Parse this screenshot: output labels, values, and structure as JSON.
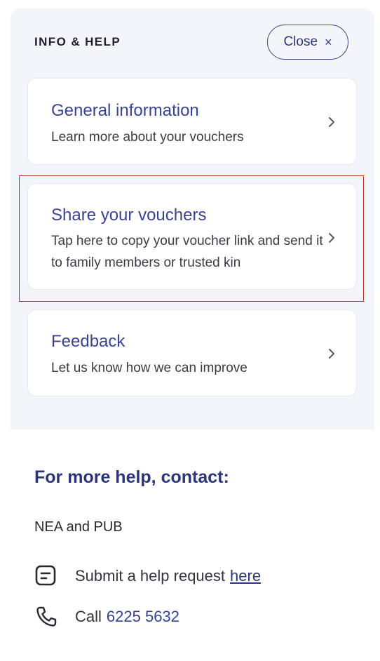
{
  "panel": {
    "title": "INFO & HELP",
    "close_label": "Close",
    "close_icon": "×"
  },
  "cards": [
    {
      "title": "General information",
      "description": "Learn more about your vouchers",
      "icon": "chevron-right-icon"
    },
    {
      "title": "Share your vouchers",
      "description": "Tap here to copy your voucher link and send it to family members or trusted kin",
      "icon": "chevron-right-icon",
      "highlighted": true
    },
    {
      "title": "Feedback",
      "description": "Let us know how we can improve",
      "icon": "chevron-right-icon"
    }
  ],
  "help": {
    "heading": "For more help, contact:",
    "organization": "NEA and PUB",
    "request_text": "Submit a help request",
    "request_link": "here",
    "request_icon": "note-icon",
    "call_text": "Call",
    "phone_number": "6225 5632",
    "call_icon": "phone-icon"
  },
  "colors": {
    "accent": "#3a4390",
    "panel_bg": "#f3f5fa",
    "highlight_border": "#b0372b"
  }
}
